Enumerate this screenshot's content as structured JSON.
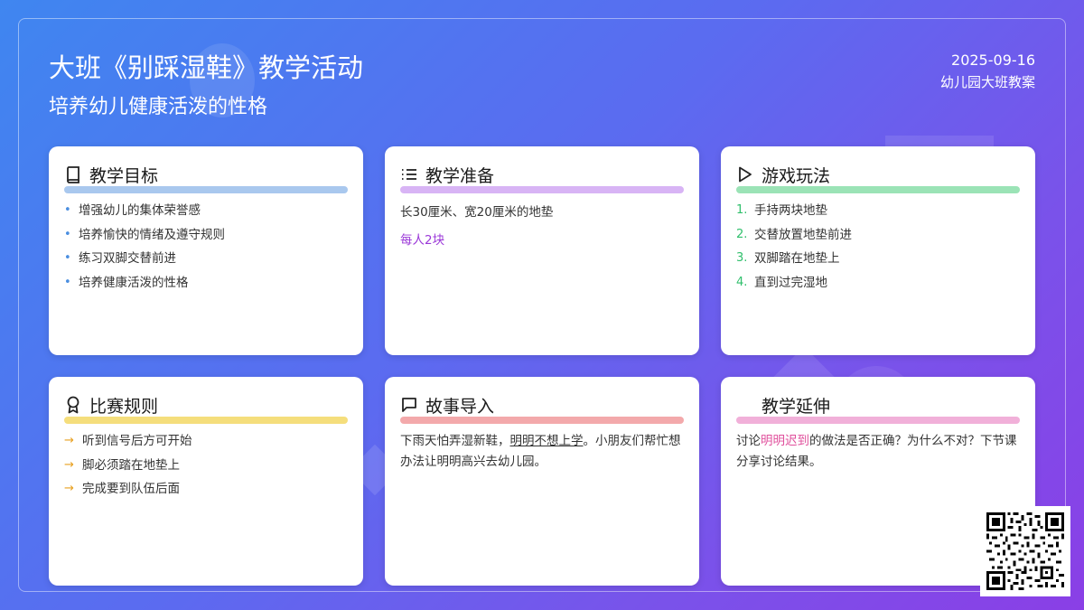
{
  "header": {
    "title": "大班《别踩湿鞋》教学活动",
    "subtitle": "培养幼儿健康活泼的性格",
    "date": "2025-09-16",
    "org": "幼儿园大班教案"
  },
  "colors": {
    "bg_start": "#3f86f0",
    "bg_end": "#8a3fe6",
    "blue": "#a9c8ee",
    "purple": "#d8b4f5",
    "green": "#9be3b6",
    "yellow": "#f5de7c",
    "red": "#f3a9ab",
    "pink": "#f1b0d9"
  },
  "cards": {
    "goals": {
      "icon": "book-icon",
      "title": "教学目标",
      "items": [
        "增强幼儿的集体荣誉感",
        "培养愉快的情绪及遵守规则",
        "练习双脚交替前进",
        "培养健康活泼的性格"
      ]
    },
    "prep": {
      "icon": "list-icon",
      "title": "教学准备",
      "line1": "长30厘米、宽20厘米的地垫",
      "line2": "每人2块"
    },
    "play": {
      "icon": "play-icon",
      "title": "游戏玩法",
      "numbers": [
        "1.",
        "2.",
        "3.",
        "4."
      ],
      "items": [
        "手持两块地垫",
        "交替放置地垫前进",
        "双脚踏在地垫上",
        "直到过完湿地"
      ]
    },
    "rules": {
      "icon": "award-icon",
      "title": "比赛规则",
      "arrow": "→",
      "items": [
        "听到信号后方可开始",
        "脚必须踏在地垫上",
        "完成要到队伍后面"
      ]
    },
    "story": {
      "icon": "chat-icon",
      "title": "故事导入",
      "part1": "下雨天怕弄湿新鞋，",
      "part2": "明明不想上学",
      "part3": "。小朋友们帮忙想办法让明明高兴去幼儿园。"
    },
    "extend": {
      "title": "教学延伸",
      "part1": "讨论",
      "part2": "明明迟到",
      "part3": "的做法是否正确？为什么不对？下节课分享讨论结果。"
    }
  }
}
